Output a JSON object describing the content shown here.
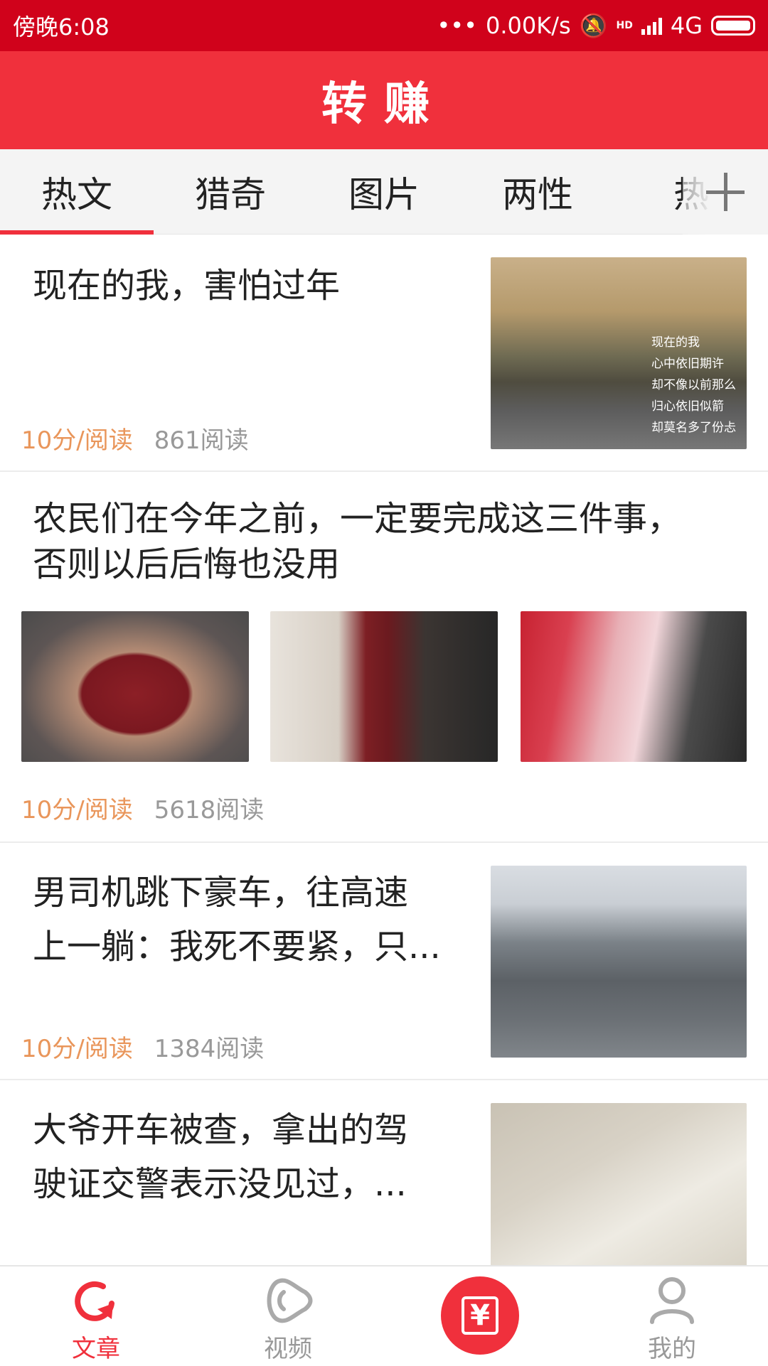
{
  "status": {
    "time": "傍晚6:08",
    "speed": "0.00K/s",
    "network": "4G",
    "hd": "HD"
  },
  "app": {
    "title": "转赚",
    "accent": "#f0303c",
    "status_bar_color": "#d0021b"
  },
  "tabs": [
    {
      "label": "热文",
      "active": true
    },
    {
      "label": "猎奇",
      "active": false
    },
    {
      "label": "图片",
      "active": false
    },
    {
      "label": "两性",
      "active": false
    },
    {
      "label": "热",
      "active": false
    }
  ],
  "articles": [
    {
      "title": "现在的我，害怕过年",
      "price": "10分/阅读",
      "reads": "861阅读",
      "image_text": [
        "现在的我",
        "心中依旧期许",
        "却不像以前那么",
        "归心依旧似箭",
        "却莫名多了份忐"
      ]
    },
    {
      "title_line1": "农民们在今年之前，一定要完成这三件事，",
      "title_line2": "否则以后后悔也没用",
      "price": "10分/阅读",
      "reads": "5618阅读"
    },
    {
      "title_line1": "男司机跳下豪车，往高速",
      "title_line2": "上一躺：我死不要紧，只...",
      "price": "10分/阅读",
      "reads": "1384阅读"
    },
    {
      "title_line1": "大爷开车被查，拿出的驾",
      "title_line2": "驶证交警表示没见过，..."
    }
  ],
  "bottom_nav": [
    {
      "label": "文章",
      "icon": "refresh-icon",
      "active": true
    },
    {
      "label": "视频",
      "icon": "video-icon",
      "active": false
    },
    {
      "label": "",
      "icon": "red-envelope-icon",
      "active": false
    },
    {
      "label": "我的",
      "icon": "person-icon",
      "active": false
    }
  ],
  "redeem_symbol": "¥"
}
